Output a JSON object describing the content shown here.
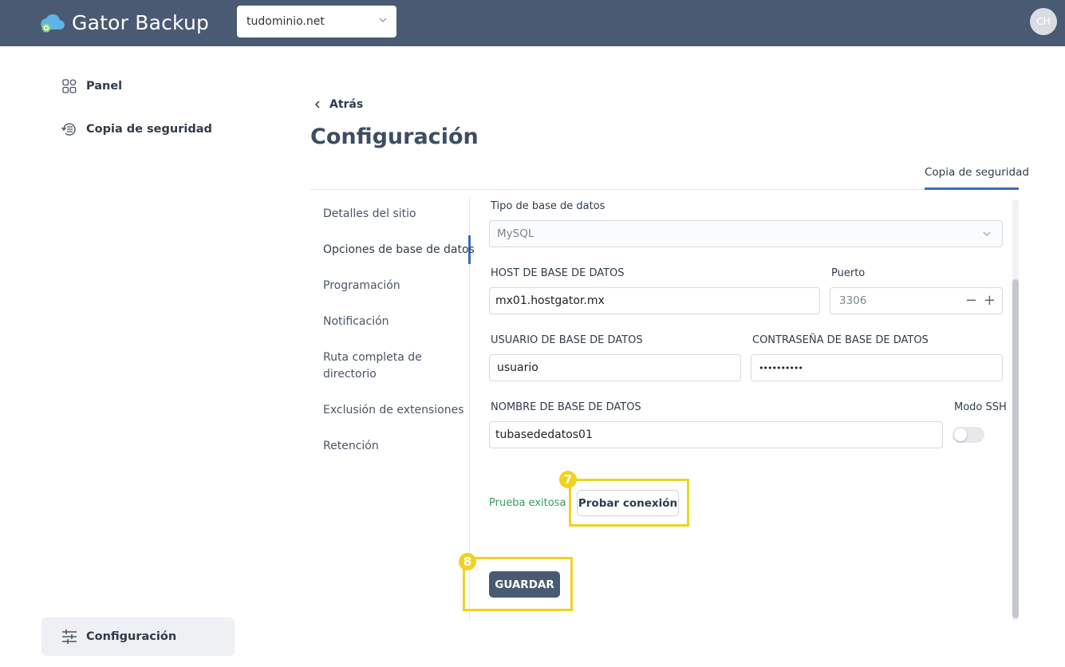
{
  "app": {
    "name": "Gator Backup",
    "user_initials": "CH"
  },
  "header": {
    "domain_value": "tudominio.net"
  },
  "sidebar": {
    "items": [
      {
        "label": "Panel",
        "icon": "dashboard-icon"
      },
      {
        "label": "Copia de seguridad",
        "icon": "backup-icon"
      }
    ],
    "settings": {
      "label": "Configuración",
      "icon": "sliders-icon"
    }
  },
  "page": {
    "back_label": "Atrás",
    "title": "Configuración",
    "active_tab": "Copia de seguridad"
  },
  "subnav": {
    "items": [
      "Detalles del sitio",
      "Opciones de base de datos",
      "Programación",
      "Notificación",
      "Ruta completa de",
      "directorio",
      "Exclusión de extensiones",
      "Retención"
    ],
    "active_index": 1
  },
  "form": {
    "db_type_label": "Tipo de base de datos",
    "db_type_value": "MySQL",
    "host_label": "HOST DE BASE DE DATOS",
    "host_value": "mx01.hostgator.mx",
    "port_label": "Puerto",
    "port_value": "3306",
    "user_label": "USUARIO DE BASE DE DATOS",
    "user_value": "usuario",
    "password_label": "CONTRASEÑA DE BASE DE DATOS",
    "password_value": "••••••••••",
    "dbname_label": "NOMBRE DE BASE DE DATOS",
    "dbname_value": "tubasededatos01",
    "ssh_label": "Modo SSH",
    "ssh_enabled": false,
    "test_status": "Prueba exitosa",
    "test_button": "Probar conexión",
    "save_button": "GUARDAR"
  },
  "annotations": {
    "step_test": "7",
    "step_save": "8",
    "highlight_color": "#f2d21f"
  },
  "colors": {
    "topbar": "#4a5a72",
    "accent": "#3b6fb6",
    "success": "#3a9a5b"
  }
}
